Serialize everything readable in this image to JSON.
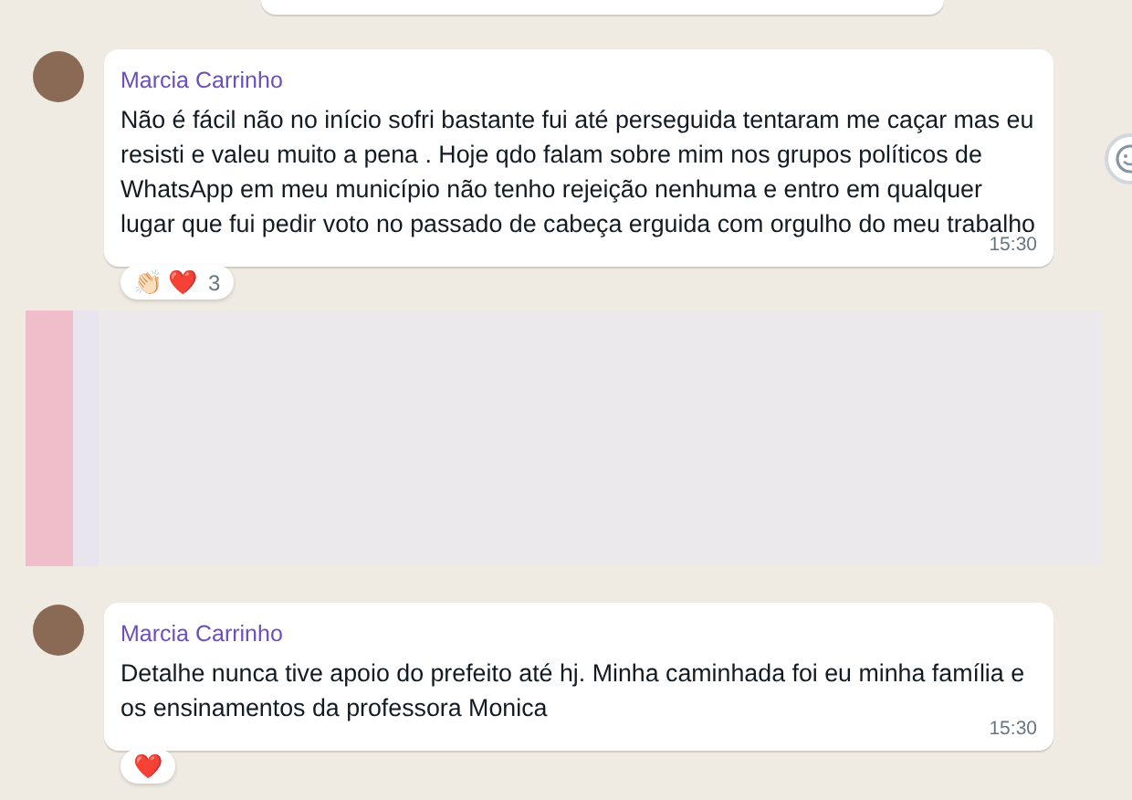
{
  "messages": [
    {
      "sender": "Marcia Carrinho",
      "text": "Não é fácil não no início sofri bastante fui até perseguida tentaram me caçar mas eu resisti e valeu muito a pena . Hoje qdo falam sobre mim nos grupos políticos de WhatsApp em meu município não tenho rejeição nenhuma e entro em qualquer lugar que fui pedir voto no passado de cabeça erguida com orgulho do meu trabalho",
      "time": "15:30",
      "reactions": [
        "👏🏻",
        "❤️"
      ],
      "reaction_count": "3"
    },
    {
      "sender": "Marcia Carrinho",
      "text": "Detalhe nunca tive apoio do prefeito até hj. Minha caminhada foi eu minha família e os ensinamentos da professora Monica",
      "time": "15:30",
      "reactions": [
        "❤️"
      ]
    }
  ]
}
